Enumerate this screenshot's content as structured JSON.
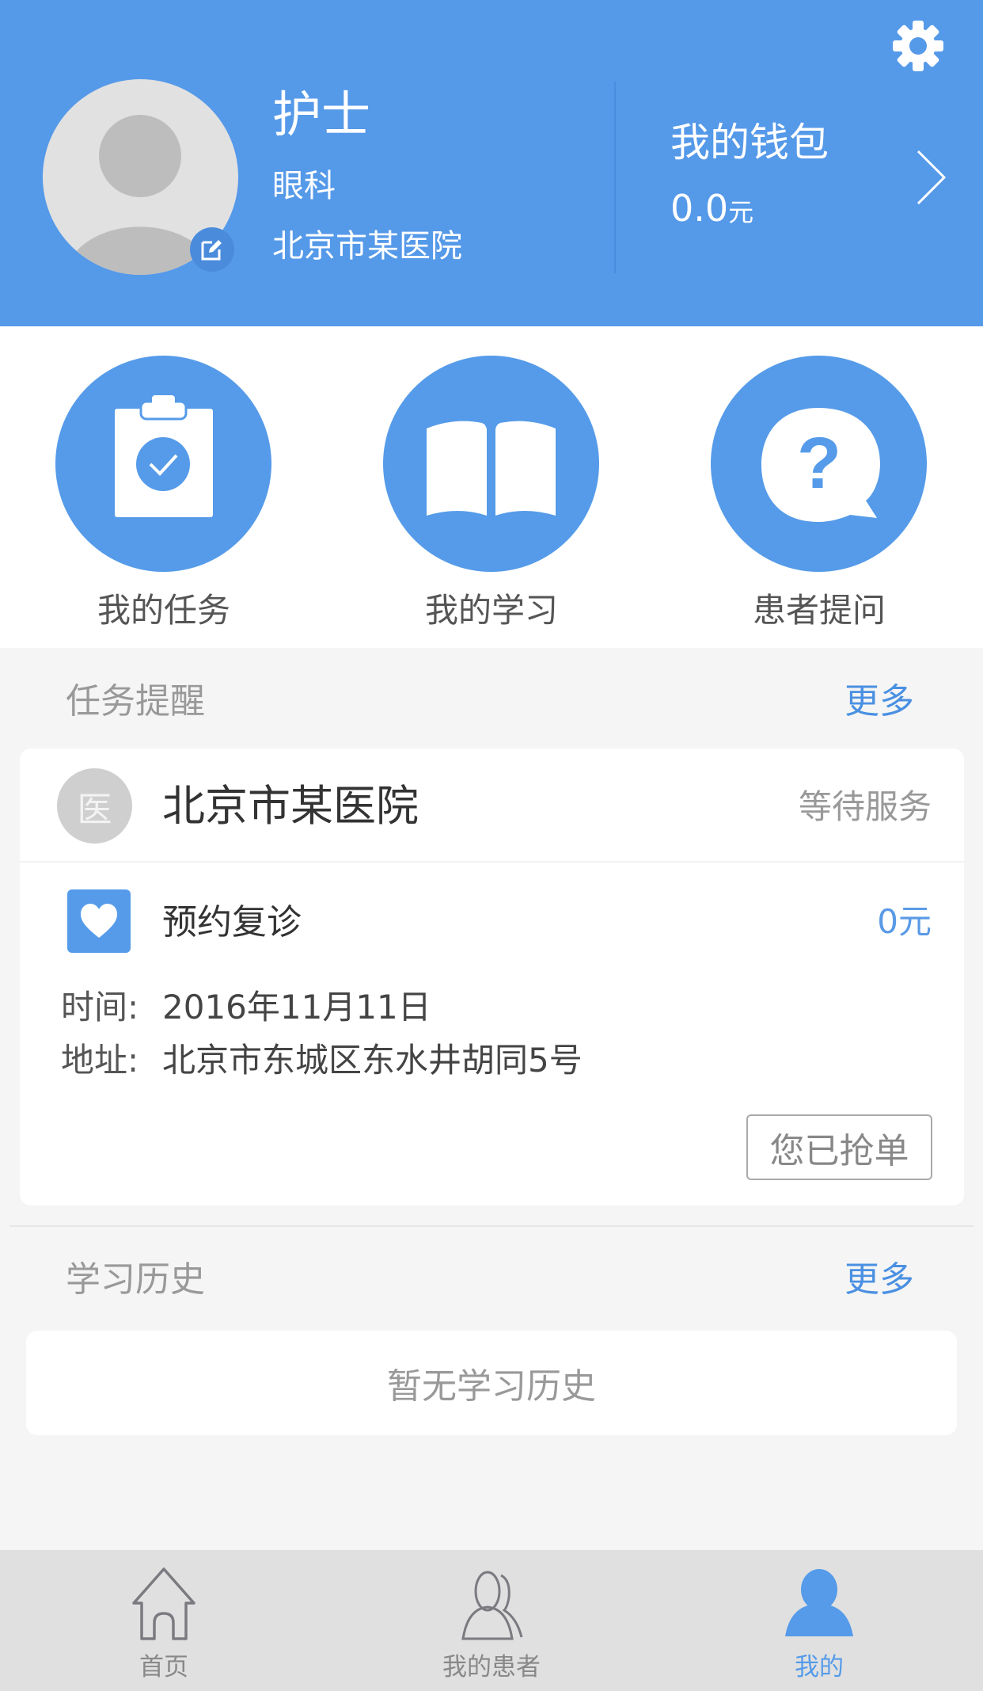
{
  "colors": {
    "brand_blue": "#5599e9",
    "link_blue": "#4a90e2",
    "page_bg": "#f5f5f5",
    "tabbar_bg": "#e0e0e0"
  },
  "header": {
    "settings_icon": "gear-icon",
    "avatar_icon": "person-placeholder-icon",
    "edit_icon": "edit-icon",
    "name": "护士",
    "department": "眼科",
    "hospital": "北京市某医院",
    "wallet": {
      "title": "我的钱包",
      "amount": "0.0",
      "unit": "元",
      "chevron_icon": "chevron-right-icon"
    }
  },
  "quick_actions": [
    {
      "label": "我的任务",
      "icon": "clipboard-check-icon"
    },
    {
      "label": "我的学习",
      "icon": "open-book-icon"
    },
    {
      "label": "患者提问",
      "icon": "question-bubble-icon"
    }
  ],
  "task_reminder": {
    "title": "任务提醒",
    "more": "更多",
    "card": {
      "avatar_text": "医",
      "hospital": "北京市某医院",
      "status": "等待服务",
      "service_icon": "heart-icon",
      "service_name": "预约复诊",
      "price": "0元",
      "time_label": "时间:",
      "time_value": "2016年11月11日",
      "address_label": "地址:",
      "address_value": "北京市东城区东水井胡同5号",
      "action_button": "您已抢单"
    }
  },
  "study_history": {
    "title": "学习历史",
    "more": "更多",
    "empty_text": "暂无学习历史"
  },
  "tabbar": {
    "active_index": 2,
    "items": [
      {
        "label": "首页",
        "icon": "home-icon"
      },
      {
        "label": "我的患者",
        "icon": "patients-icon"
      },
      {
        "label": "我的",
        "icon": "profile-icon"
      }
    ]
  }
}
